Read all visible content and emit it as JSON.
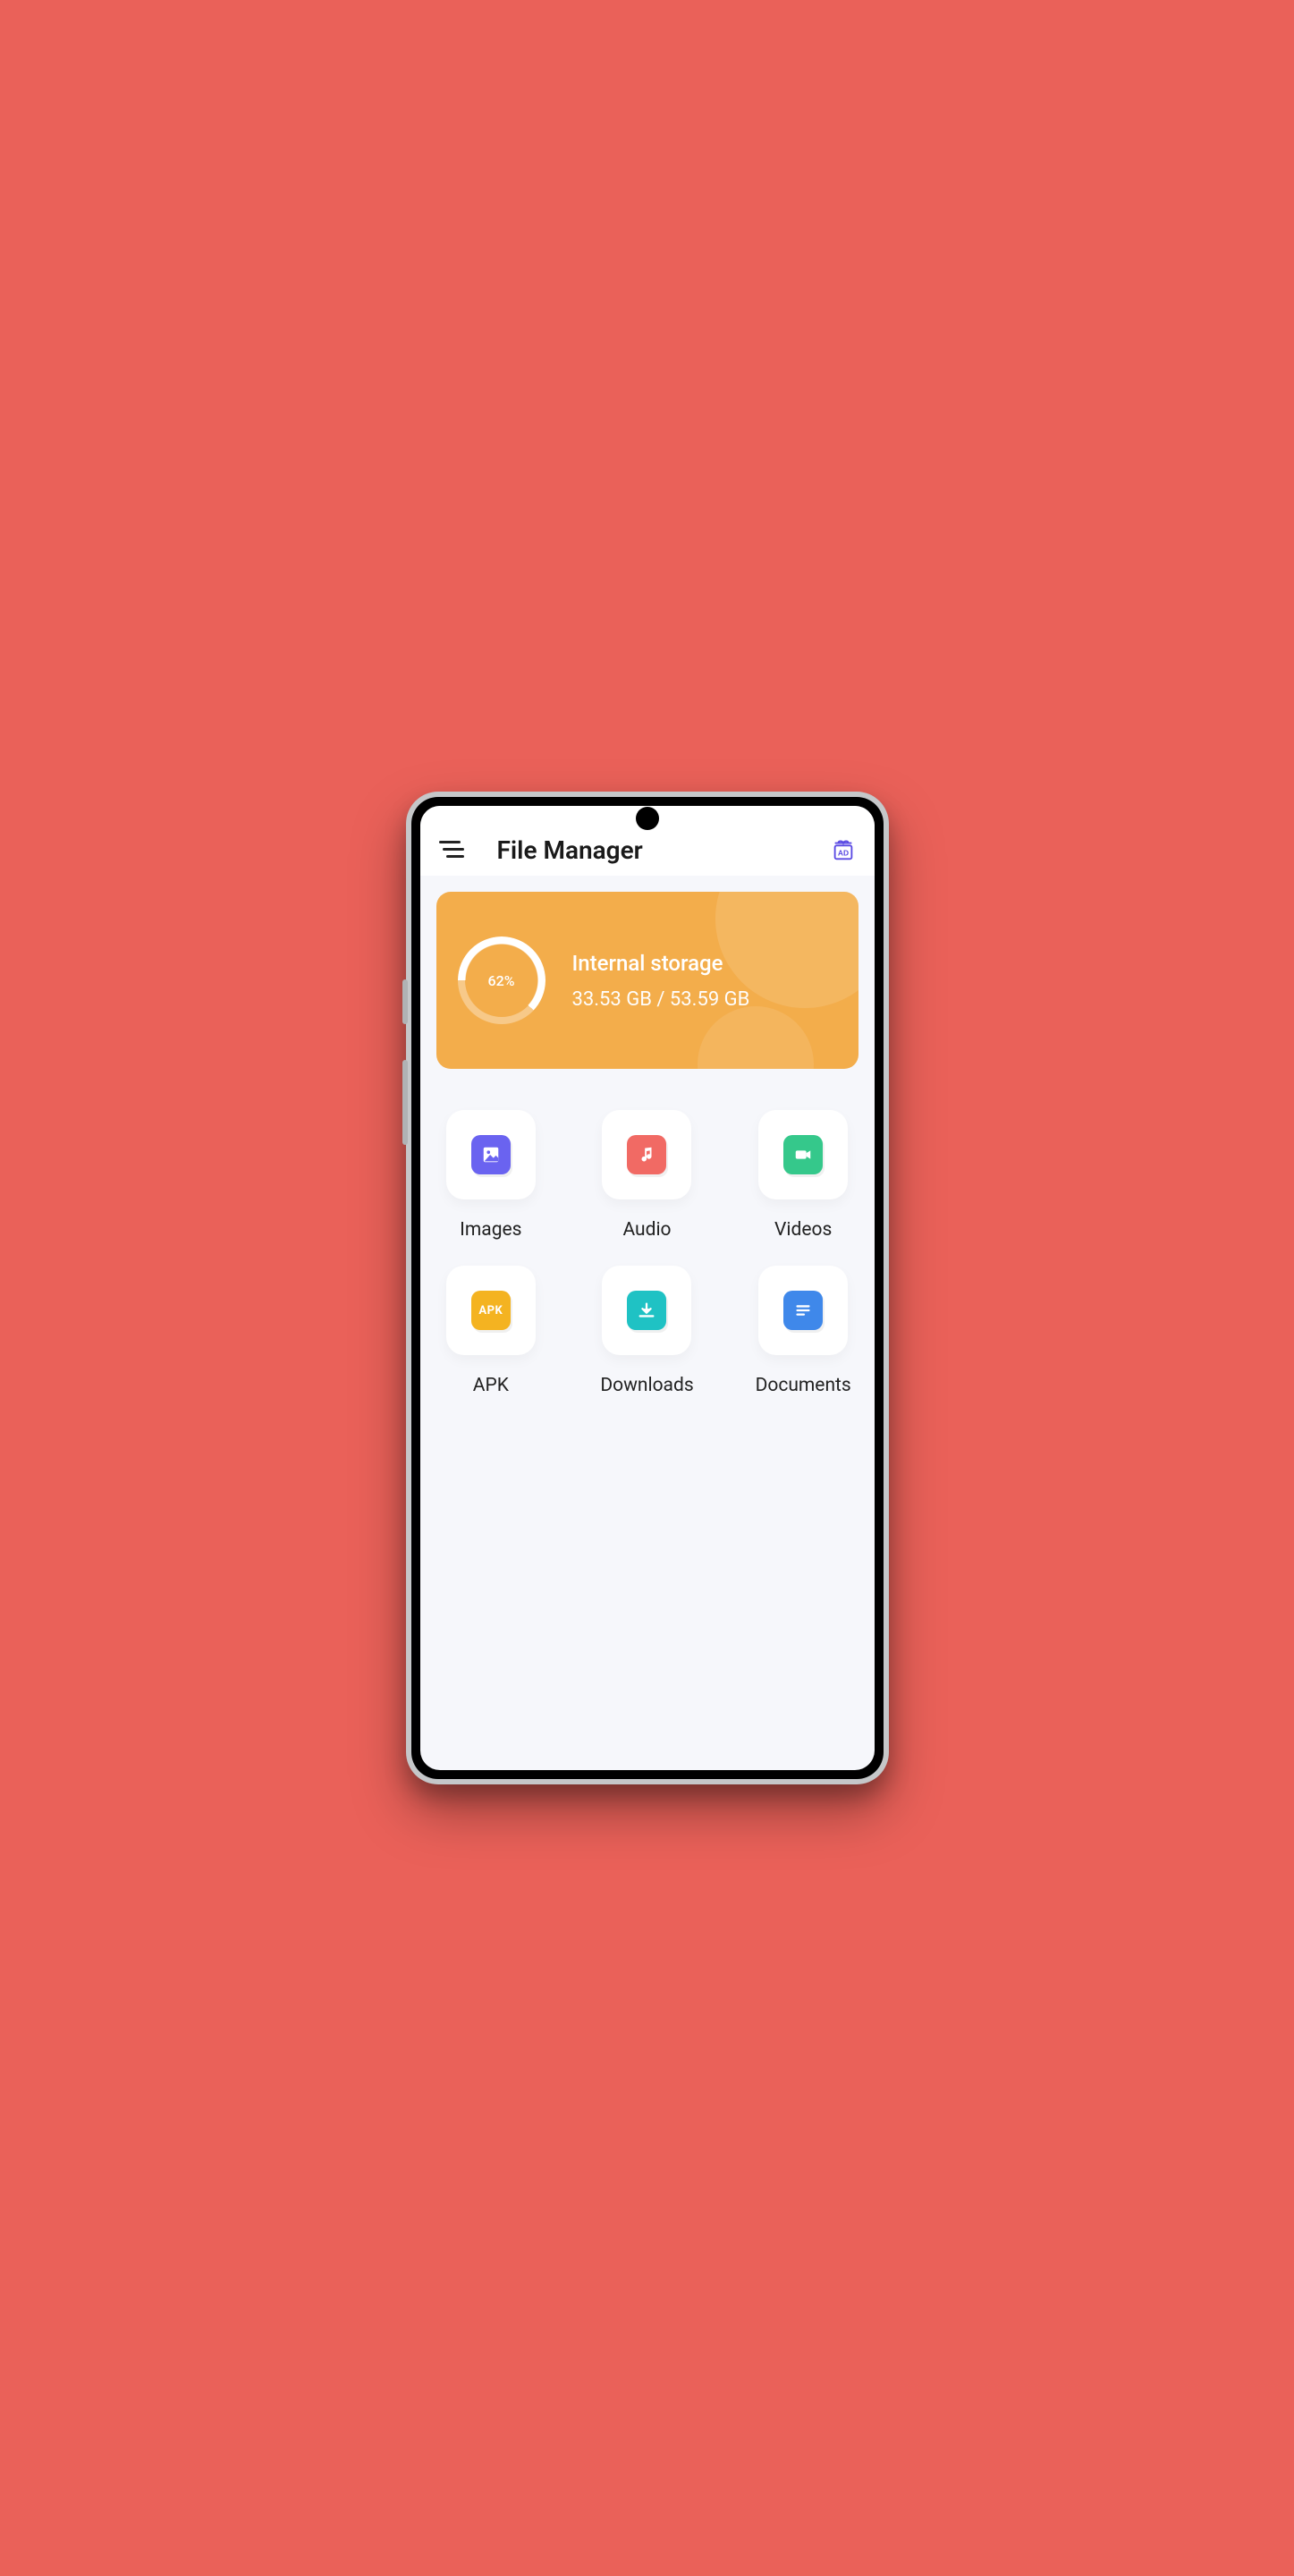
{
  "header": {
    "title": "File Manager"
  },
  "storage": {
    "title": "Internal storage",
    "used_gb": "33.53 GB",
    "total_gb": "53.59 GB",
    "percent": 62,
    "percent_label": "62%"
  },
  "categories": [
    {
      "key": "images",
      "label": "Images",
      "icon": "image",
      "color": "#6a63f0"
    },
    {
      "key": "audio",
      "label": "Audio",
      "icon": "music",
      "color": "#f16a64"
    },
    {
      "key": "videos",
      "label": "Videos",
      "icon": "video",
      "color": "#35c88b"
    },
    {
      "key": "apk",
      "label": "APK",
      "icon": "apk",
      "color": "#f4b321"
    },
    {
      "key": "downloads",
      "label": "Downloads",
      "icon": "download",
      "color": "#1fc2c4"
    },
    {
      "key": "documents",
      "label": "Documents",
      "icon": "document",
      "color": "#3f88ea"
    }
  ]
}
